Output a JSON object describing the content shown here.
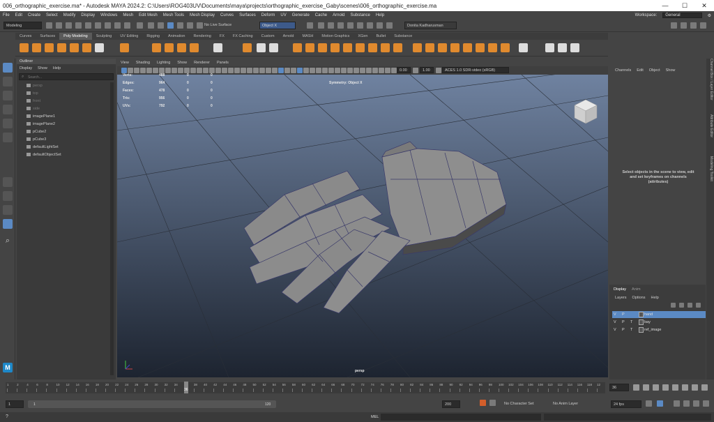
{
  "window": {
    "title": "006_orthographic_exercise.ma* - Autodesk MAYA 2024.2: C:\\Users\\ROG403UV\\Documents\\maya\\projects\\orthographic_exercise_Gaby\\scenes\\006_orthographic_exercise.ma",
    "minimize": "—",
    "maximize": "☐",
    "close": "✕"
  },
  "menubar": {
    "items": [
      "File",
      "Edit",
      "Create",
      "Select",
      "Modify",
      "Display",
      "Windows",
      "Mesh",
      "Edit Mesh",
      "Mesh Tools",
      "Mesh Display",
      "Curves",
      "Surfaces",
      "Deform",
      "UV",
      "Generate",
      "Cache",
      "Arnold",
      "Substance",
      "Help"
    ],
    "workspace_label": "Workspace:",
    "workspace_value": "General"
  },
  "statusline": {
    "mode": "Modeling",
    "live_surface": "No Live Surface",
    "symmetry": "Object X",
    "user": "Donita Kadharusman"
  },
  "shelf": {
    "tabs": [
      "Curves",
      "Surfaces",
      "Poly Modeling",
      "Sculpting",
      "UV Editing",
      "Rigging",
      "Animation",
      "Rendering",
      "FX",
      "FX Caching",
      "Custom",
      "Arnold",
      "MASH",
      "Motion Graphics",
      "XGen",
      "Bullet",
      "Substance"
    ],
    "active_tab": "Poly Modeling"
  },
  "outliner": {
    "title": "Outliner",
    "menu": [
      "Display",
      "Show",
      "Help"
    ],
    "search_placeholder": "Search...",
    "items": [
      {
        "label": "persp",
        "dim": true,
        "icon": "camera-icon"
      },
      {
        "label": "top",
        "dim": true,
        "icon": "camera-icon"
      },
      {
        "label": "front",
        "dim": true,
        "icon": "camera-icon"
      },
      {
        "label": "side",
        "dim": true,
        "icon": "camera-icon"
      },
      {
        "label": "imagePlane1",
        "dim": false,
        "icon": "image-plane-icon"
      },
      {
        "label": "imagePlane2",
        "dim": false,
        "icon": "image-plane-icon"
      },
      {
        "label": "pCube2",
        "dim": false,
        "icon": "mesh-icon"
      },
      {
        "label": "pCube3",
        "dim": false,
        "icon": "mesh-icon"
      },
      {
        "label": "defaultLightSet",
        "dim": false,
        "icon": "set-icon"
      },
      {
        "label": "defaultObjectSet",
        "dim": false,
        "icon": "set-icon"
      }
    ]
  },
  "viewport": {
    "menu": [
      "View",
      "Shading",
      "Lighting",
      "Show",
      "Renderer",
      "Panels"
    ],
    "exposure": "0.00",
    "gamma": "1.00",
    "colorspace": "ACES 1.0 SDR-video (sRGB)",
    "symmetry_label": "Symmetry: Object X",
    "camera": "persp",
    "hud": [
      {
        "label": "Verts:",
        "a": "488",
        "b": "0",
        "c": "0"
      },
      {
        "label": "Edges:",
        "a": "964",
        "b": "0",
        "c": "0"
      },
      {
        "label": "Faces:",
        "a": "478",
        "b": "0",
        "c": "0"
      },
      {
        "label": "Tris:",
        "a": "956",
        "b": "0",
        "c": "0"
      },
      {
        "label": "UVs:",
        "a": "792",
        "b": "0",
        "c": "0"
      }
    ],
    "colors": {
      "bg_top": "#6f82a0",
      "bg_bottom": "#1d2430",
      "mesh": "#8e8e8e",
      "mesh_dark": "#5a5a5a",
      "wire": "#3a3a6a"
    }
  },
  "channelbox": {
    "menu": [
      "Channels",
      "Edit",
      "Object",
      "Show"
    ],
    "message": "Select objects in the scene to view, edit and set keyframes on channels (attributes)"
  },
  "sidetabs": [
    "Channel Box / Layer Editor",
    "Attribute Editor",
    "Modeling Toolkit"
  ],
  "layers": {
    "tabs": [
      "Display",
      "Anim"
    ],
    "menu": [
      "Layers",
      "Options",
      "Help"
    ],
    "items": [
      {
        "v": "V",
        "p": "P",
        "t": "",
        "name": "hand",
        "selected": true
      },
      {
        "v": "V",
        "p": "P",
        "t": "T",
        "name": "bay",
        "selected": false
      },
      {
        "v": "V",
        "p": "P",
        "t": "T",
        "name": "ref_image",
        "selected": false
      }
    ]
  },
  "timeline": {
    "ticks": [
      "1",
      "2",
      "4",
      "6",
      "8",
      "10",
      "12",
      "14",
      "16",
      "18",
      "20",
      "22",
      "24",
      "26",
      "28",
      "30",
      "32",
      "34",
      "36",
      "38",
      "40",
      "42",
      "44",
      "46",
      "48",
      "50",
      "52",
      "54",
      "56",
      "58",
      "60",
      "62",
      "64",
      "66",
      "68",
      "70",
      "72",
      "74",
      "76",
      "78",
      "80",
      "82",
      "84",
      "86",
      "88",
      "90",
      "92",
      "94",
      "96",
      "98",
      "100",
      "102",
      "104",
      "106",
      "108",
      "110",
      "112",
      "114",
      "116",
      "118",
      "12"
    ],
    "current_frame": "36",
    "current_field": "36",
    "range_start": "1",
    "range_inner_start": "1",
    "range_inner_end": "120",
    "range_end": "200",
    "character_set": "No Character Set",
    "anim_layer": "No Anim Layer",
    "fps": "24 fps"
  },
  "cmdline": {
    "label": "MEL"
  }
}
